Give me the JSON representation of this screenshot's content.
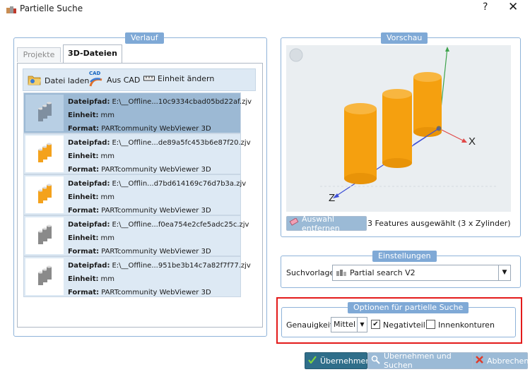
{
  "window": {
    "title": "Partielle Suche",
    "help": "?",
    "close": "✕"
  },
  "history": {
    "group_title": "Verlauf",
    "tabs": [
      {
        "label": "Projekte"
      },
      {
        "label": "3D-Dateien"
      }
    ],
    "toolbar": {
      "load_label": "Datei laden",
      "cad_badge": "CAD",
      "from_cad_label": "Aus CAD",
      "unit_label": "Einheit ändern"
    },
    "field_labels": {
      "path": "Dateipfad:",
      "unit": "Einheit:",
      "format": "Format:"
    },
    "items": [
      {
        "path": "E:\\__Offline...10c9334cbad05bd22af.zjv",
        "unit": "mm",
        "format": "PARTcommunity WebViewer 3D",
        "color": "#7f8fa0"
      },
      {
        "path": "E:\\__Offline...de89a5fc453b6e87f20.zjv",
        "unit": "mm",
        "format": "PARTcommunity WebViewer 3D",
        "color": "#f4a21c"
      },
      {
        "path": "E:\\__Offlin...d7bd614169c76d7b3a.zjv",
        "unit": "mm",
        "format": "PARTcommunity WebViewer 3D",
        "color": "#f4a21c"
      },
      {
        "path": "E:\\__Offline...f0ea754e2cfe5adc25c.zjv",
        "unit": "mm",
        "format": "PARTcommunity WebViewer 3D",
        "color": "#8a8a8a"
      },
      {
        "path": "E:\\__Offline...951be3b14c7a82f7f77.zjv",
        "unit": "mm",
        "format": "PARTcommunity WebViewer 3D",
        "color": "#8a8a8a"
      }
    ]
  },
  "preview": {
    "group_title": "Vorschau",
    "axis_x": "X",
    "axis_z": "Z",
    "remove_selection_label": "Auswahl entfernen",
    "selection_status": "3 Features ausgewählt (3 x Zylinder)",
    "cylinder_color": "#f5a00f"
  },
  "settings": {
    "group_title": "Einstellungen",
    "template_label": "Suchvorlage:",
    "template_value": "Partial search V2"
  },
  "options": {
    "group_title": "Optionen für partielle Suche",
    "accuracy_label": "Genauigkeit:",
    "accuracy_value": "Mittel",
    "negative_label": "Negativteil",
    "negative_checked": true,
    "inner_contours_label": "Innenkonturen",
    "inner_contours_checked": false
  },
  "buttons": {
    "apply": "Übernehmen",
    "apply_search": "Übernehmen und Suchen",
    "cancel": "Abbrechen"
  }
}
